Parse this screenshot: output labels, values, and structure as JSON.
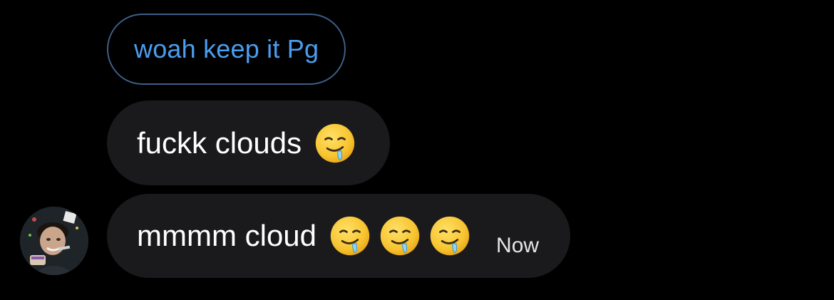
{
  "reply": {
    "text": "woah keep it Pg"
  },
  "messages": [
    {
      "text": "fuckk clouds",
      "emojis": [
        "drooling-face"
      ],
      "timestamp": ""
    },
    {
      "text": "mmmm cloud",
      "emojis": [
        "drooling-face",
        "drooling-face",
        "drooling-face"
      ],
      "timestamp": "Now"
    }
  ],
  "colors": {
    "background": "#000000",
    "bubble": "#1a1a1c",
    "reply_text": "#4a9ef0",
    "reply_border": "#3b5f86",
    "emoji_face": "#f7c430"
  }
}
